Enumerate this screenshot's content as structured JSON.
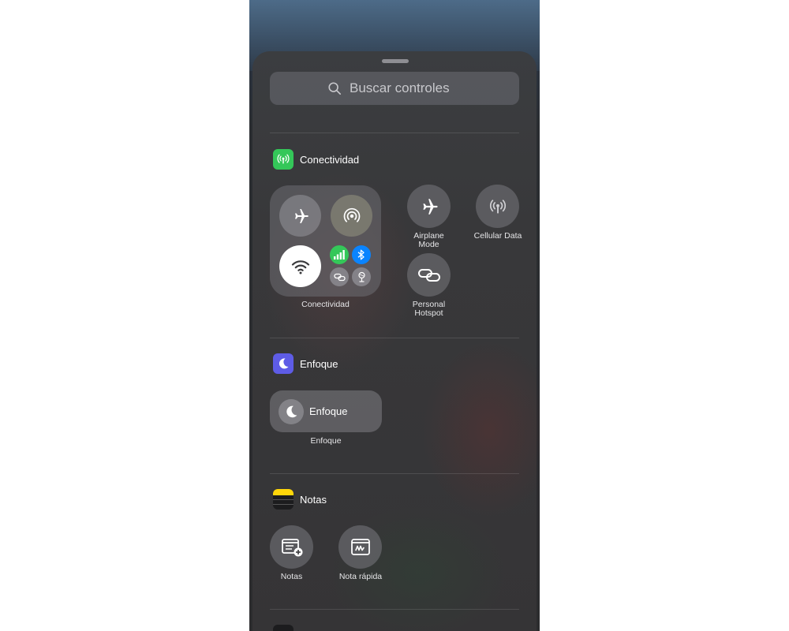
{
  "search": {
    "placeholder": "Buscar controles"
  },
  "sections": {
    "connectivity": {
      "title": "Conectividad",
      "block_label": "Conectividad",
      "airplane_label": "Airplane Mode",
      "cellular_label": "Cellular Data",
      "hotspot_label": "Personal Hotspot"
    },
    "focus": {
      "title": "Enfoque",
      "pill_label": "Enfoque",
      "caption": "Enfoque"
    },
    "notes": {
      "title": "Notas",
      "notes_label": "Notas",
      "quick_note_label": "Nota rápida"
    }
  },
  "colors": {
    "green": "#34c759",
    "blue": "#0a84ff",
    "indigo": "#5e5ce6",
    "yellow": "#ffd60a"
  }
}
